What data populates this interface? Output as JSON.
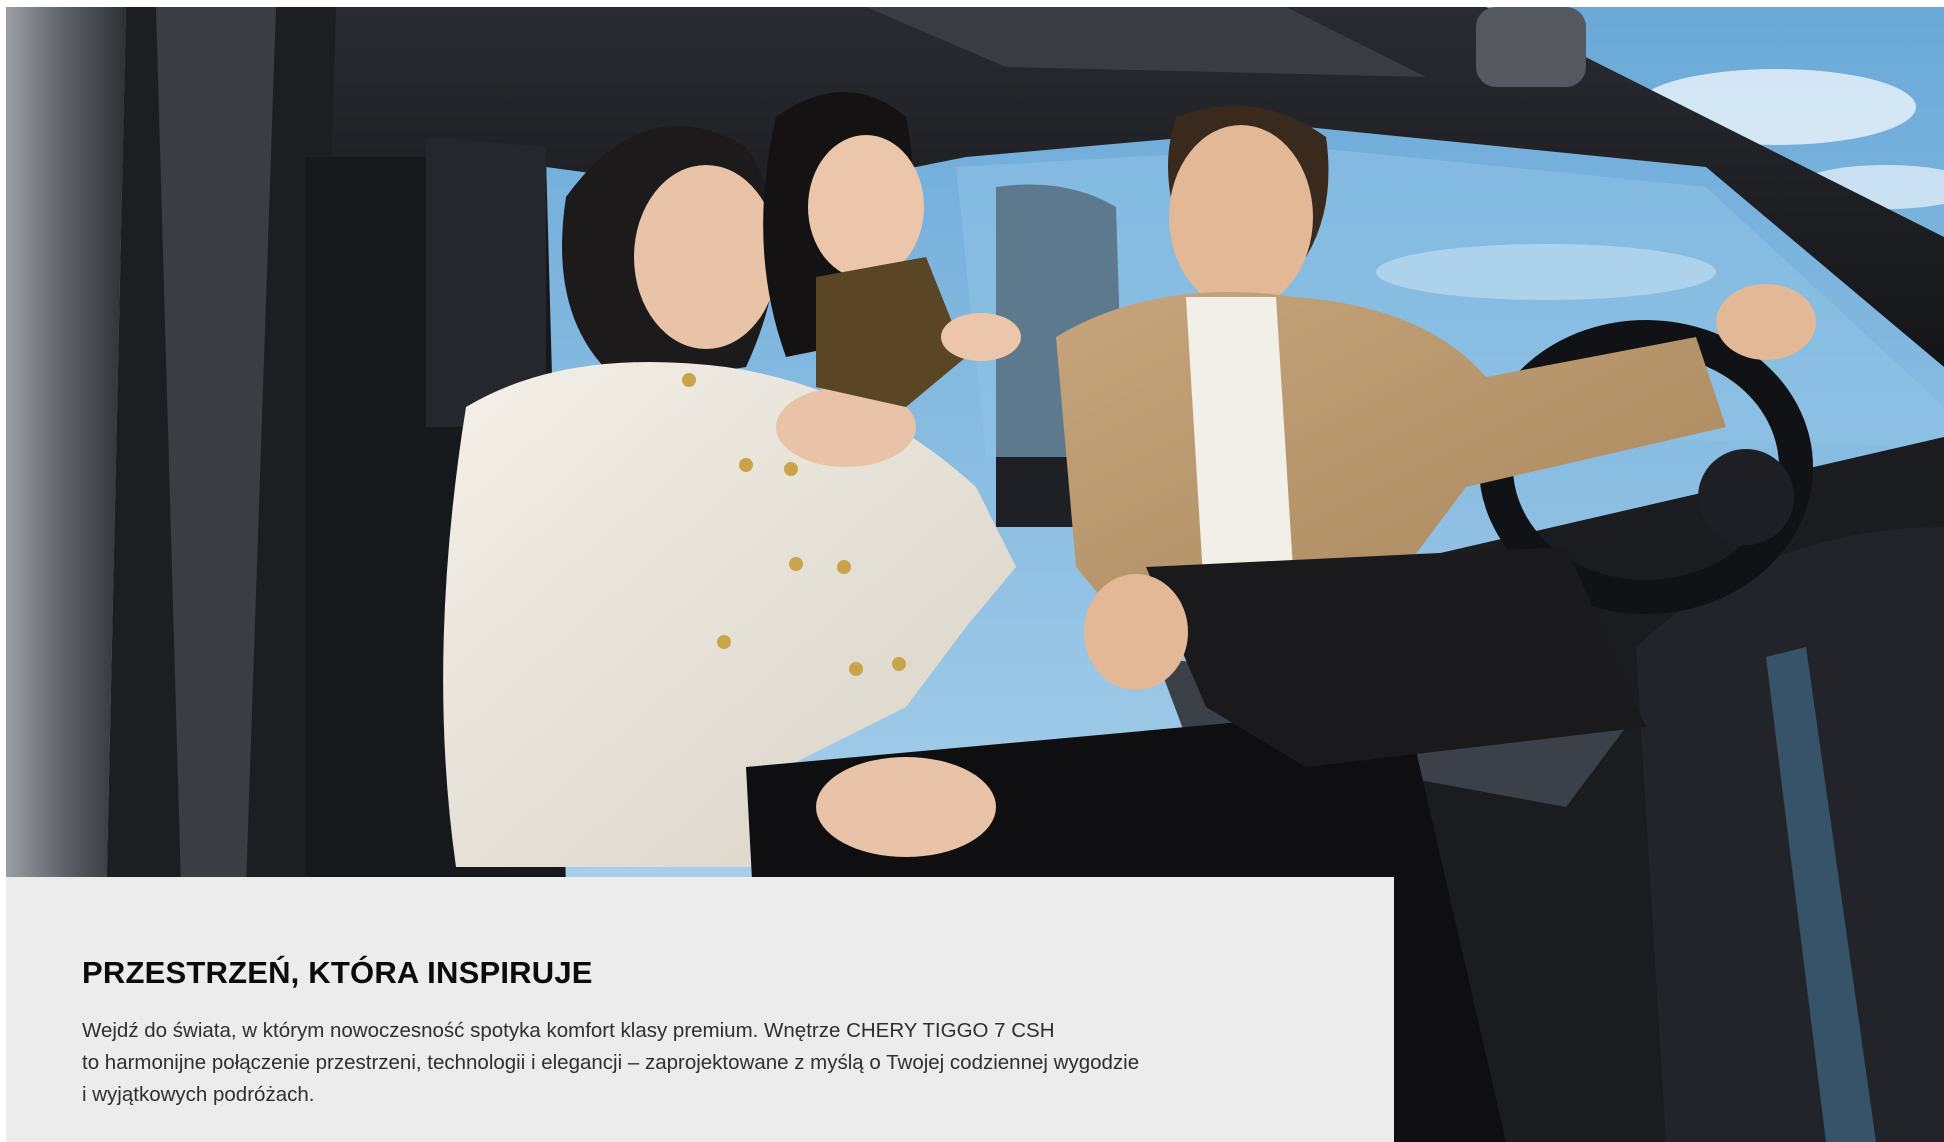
{
  "hero": {
    "image_description_icon": "car-interior-photo-icon"
  },
  "section": {
    "title": "PRZESTRZEŃ, KTÓRA INSPIRUJE",
    "body_lines": [
      "Wejdź do świata, w którym nowoczesność spotyka komfort klasy premium. Wnętrze CHERY TIGGO 7 CSH",
      "to harmonijne połączenie przestrzeni, technologii i elegancji – zaprojektowane z myślą o Twojej codziennej wygodzie",
      "i wyjątkowych podróżach."
    ]
  },
  "colors": {
    "panel_background": "#ececec",
    "headline": "#0b0b0b",
    "body_text": "#2f2f2f",
    "sky": "#79b4dc"
  }
}
